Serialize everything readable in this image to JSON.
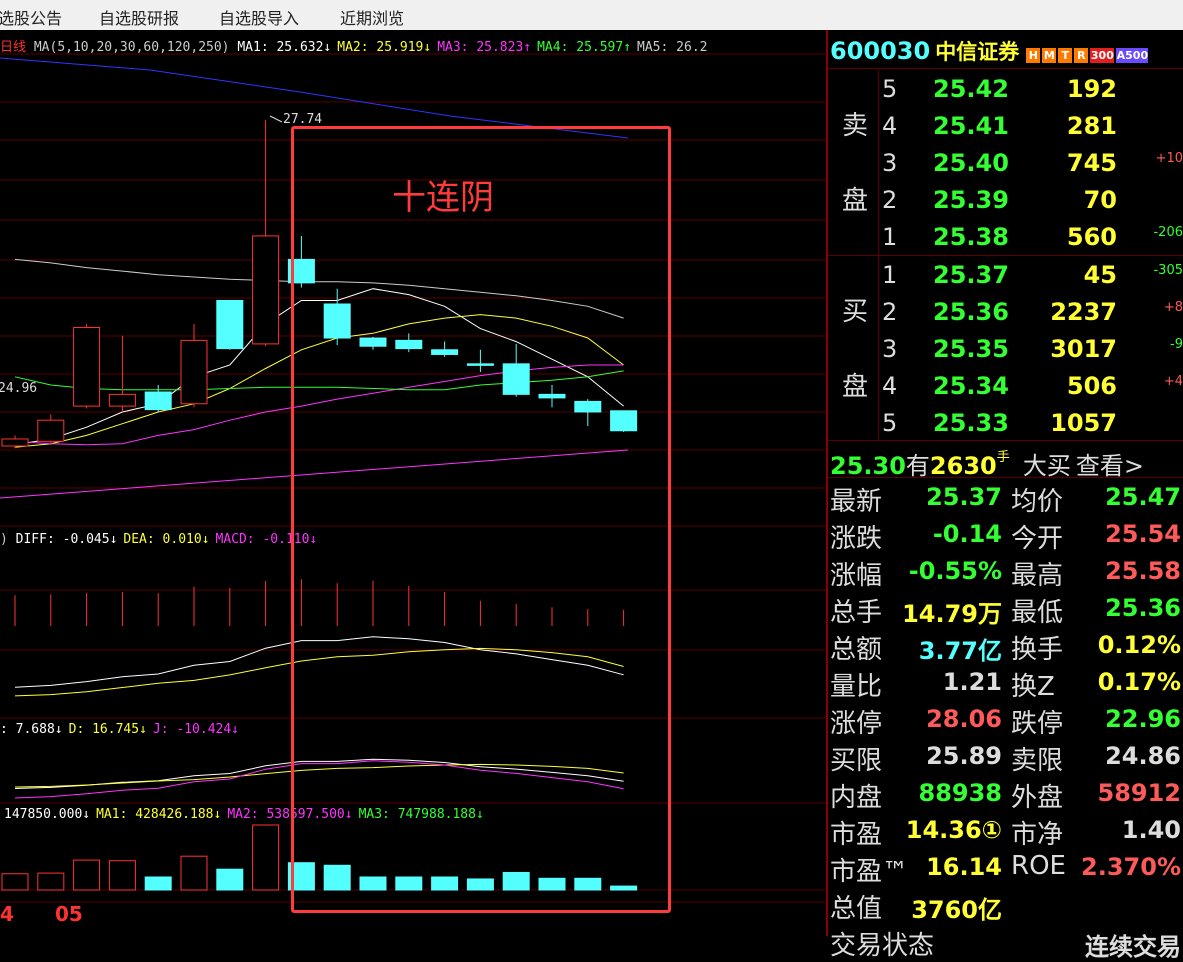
{
  "menu": {
    "items": [
      "选股公告",
      "自选股研报",
      "自选股导入",
      "近期浏览"
    ]
  },
  "chart": {
    "period_label": "日线",
    "ma_header": {
      "prefix": "MA(5,10,20,30,60,120,250)",
      "items": [
        {
          "label": "MA1: 25.632↓",
          "color": "#ffffff"
        },
        {
          "label": "MA2: 25.919↓",
          "color": "#ffff33"
        },
        {
          "label": "MA3: 25.823↑",
          "color": "#ff33ff"
        },
        {
          "label": "MA4: 25.597↑",
          "color": "#33ff33"
        },
        {
          "label": "MA5: 26.2",
          "color": "#cccccc"
        }
      ]
    },
    "high_marker": "27.74",
    "low_marker": "24.96",
    "annotation": "十连阴",
    "macd_header": {
      "prefix": ")",
      "items": [
        {
          "label": "DIFF: -0.045↓",
          "color": "#ffffff"
        },
        {
          "label": "DEA: 0.010↓",
          "color": "#ffff33"
        },
        {
          "label": "MACD: -0.110↓",
          "color": "#ff33ff"
        }
      ]
    },
    "kdj_header": {
      "items": [
        {
          "label": ": 7.688↓",
          "color": "#ffffff"
        },
        {
          "label": "D: 16.745↓",
          "color": "#ffff33"
        },
        {
          "label": "J: -10.424↓",
          "color": "#ff33ff"
        }
      ]
    },
    "vol_header": {
      "items": [
        {
          "label": "147850.000↓",
          "color": "#ffffff"
        },
        {
          "label": "MA1: 428426.188↓",
          "color": "#ffff33"
        },
        {
          "label": "MA2: 538597.500↓",
          "color": "#ff33ff"
        },
        {
          "label": "MA3: 747988.188↓",
          "color": "#33ff33"
        }
      ]
    },
    "date_labels": [
      "4",
      "05"
    ],
    "colors": {
      "up": "#ff3232",
      "down": "#54ffff",
      "grid": "#5a0000",
      "annotation_box": "#ff3b3b"
    }
  },
  "chart_data": {
    "type": "candlestick",
    "candles": [
      {
        "o": 24.96,
        "h": 25.05,
        "l": 24.94,
        "c": 25.02
      },
      {
        "o": 25.0,
        "h": 25.23,
        "l": 24.97,
        "c": 25.18
      },
      {
        "o": 25.3,
        "h": 26.0,
        "l": 25.28,
        "c": 25.97
      },
      {
        "o": 25.3,
        "h": 25.9,
        "l": 25.25,
        "c": 25.4
      },
      {
        "o": 25.42,
        "h": 25.48,
        "l": 25.25,
        "c": 25.27
      },
      {
        "o": 25.32,
        "h": 26.0,
        "l": 25.29,
        "c": 25.86
      },
      {
        "o": 26.2,
        "h": 26.2,
        "l": 25.78,
        "c": 25.79
      },
      {
        "o": 25.83,
        "h": 27.74,
        "l": 25.81,
        "c": 26.75
      },
      {
        "o": 26.55,
        "h": 26.75,
        "l": 26.31,
        "c": 26.35
      },
      {
        "o": 26.17,
        "h": 26.3,
        "l": 25.82,
        "c": 25.88
      },
      {
        "o": 25.88,
        "h": 25.89,
        "l": 25.78,
        "c": 25.81
      },
      {
        "o": 25.86,
        "h": 25.92,
        "l": 25.76,
        "c": 25.79
      },
      {
        "o": 25.78,
        "h": 25.85,
        "l": 25.72,
        "c": 25.74
      },
      {
        "o": 25.66,
        "h": 25.78,
        "l": 25.59,
        "c": 25.65
      },
      {
        "o": 25.66,
        "h": 25.83,
        "l": 25.38,
        "c": 25.4
      },
      {
        "o": 25.4,
        "h": 25.48,
        "l": 25.29,
        "c": 25.37
      },
      {
        "o": 25.34,
        "h": 25.36,
        "l": 25.13,
        "c": 25.25
      },
      {
        "o": 25.26,
        "h": 25.26,
        "l": 25.08,
        "c": 25.09
      }
    ],
    "ylim": [
      24.5,
      28.3
    ],
    "volume_ylim": [
      0,
      1000000
    ],
    "volumes": [
      250000,
      260000,
      460000,
      450000,
      200000,
      520000,
      320000,
      1000000,
      420000,
      380000,
      200000,
      200000,
      200000,
      170000,
      270000,
      180000,
      180000,
      60000
    ],
    "ma_lines": [
      {
        "name": "MA1",
        "color": "#ffffff",
        "values": [
          24.97,
          25.02,
          25.12,
          25.25,
          25.32,
          25.55,
          25.65,
          26.0,
          26.2,
          26.2,
          26.3,
          26.25,
          26.15,
          25.96,
          25.85,
          25.7,
          25.55,
          25.3
        ]
      },
      {
        "name": "MA2",
        "color": "#ffff33",
        "values": [
          24.95,
          24.98,
          25.05,
          25.15,
          25.25,
          25.32,
          25.45,
          25.62,
          25.78,
          25.88,
          25.92,
          26.0,
          26.05,
          26.08,
          26.05,
          25.98,
          25.88,
          25.65
        ]
      },
      {
        "name": "MA3",
        "color": "#ff33ff",
        "values": [
          25.0,
          24.98,
          24.97,
          24.98,
          25.05,
          25.1,
          25.18,
          25.25,
          25.3,
          25.36,
          25.41,
          25.46,
          25.51,
          25.56,
          25.6,
          25.63,
          25.65,
          25.65
        ]
      },
      {
        "name": "MA4",
        "color": "#33ff33",
        "values": [
          25.55,
          25.48,
          25.45,
          25.44,
          25.44,
          25.44,
          25.45,
          25.46,
          25.46,
          25.46,
          25.45,
          25.44,
          25.44,
          25.48,
          25.5,
          25.52,
          25.55,
          25.6
        ]
      },
      {
        "name": "MA5",
        "color": "#cccccc",
        "values": [
          26.55,
          26.52,
          26.48,
          26.45,
          26.42,
          26.4,
          26.38,
          26.37,
          26.36,
          26.36,
          26.35,
          26.33,
          26.3,
          26.27,
          26.24,
          26.2,
          26.15,
          26.05
        ]
      }
    ]
  },
  "quote": {
    "code": "600030",
    "name": "中信证券",
    "badges": [
      {
        "label": "H",
        "color": "#ff7a00"
      },
      {
        "label": "M",
        "color": "#ff7a00"
      },
      {
        "label": "T",
        "color": "#ff7a00"
      },
      {
        "label": "R",
        "color": "#ff7a00"
      },
      {
        "label": "300",
        "color": "#e02020"
      },
      {
        "label": "A500",
        "color": "#6a4bff"
      }
    ],
    "sell_label_top": "卖",
    "sell_label_bottom": "盘",
    "buy_label_top": "买",
    "buy_label_bottom": "盘",
    "sell": [
      {
        "level": "5",
        "price": "25.42",
        "vol": "192",
        "chg": ""
      },
      {
        "level": "4",
        "price": "25.41",
        "vol": "281",
        "chg": ""
      },
      {
        "level": "3",
        "price": "25.40",
        "vol": "745",
        "chg": "+10"
      },
      {
        "level": "2",
        "price": "25.39",
        "vol": "70",
        "chg": ""
      },
      {
        "level": "1",
        "price": "25.38",
        "vol": "560",
        "chg": "-206"
      }
    ],
    "buy": [
      {
        "level": "1",
        "price": "25.37",
        "vol": "45",
        "chg": "-305"
      },
      {
        "level": "2",
        "price": "25.36",
        "vol": "2237",
        "chg": "+8"
      },
      {
        "level": "3",
        "price": "25.35",
        "vol": "3017",
        "chg": "-9"
      },
      {
        "level": "4",
        "price": "25.34",
        "vol": "506",
        "chg": "+4"
      },
      {
        "level": "5",
        "price": "25.33",
        "vol": "1057",
        "chg": ""
      }
    ],
    "big_order": {
      "price": "25.30",
      "has": "有",
      "qty": "2630",
      "unit": "手",
      "type": "大买",
      "view": "查看>"
    },
    "stats": [
      {
        "l1": "最新",
        "v1": "25.37",
        "c1": "#33ff33",
        "l2": "均价",
        "v2": "25.47",
        "c2": "#33ff33"
      },
      {
        "l1": "涨跌",
        "v1": "-0.14",
        "c1": "#33ff33",
        "l2": "今开",
        "v2": "25.54",
        "c2": "#ff5a5a"
      },
      {
        "l1": "涨幅",
        "v1": "-0.55%",
        "c1": "#33ff33",
        "l2": "最高",
        "v2": "25.58",
        "c2": "#ff5a5a"
      },
      {
        "l1": "总手",
        "v1": "14.79万",
        "c1": "#ffff33",
        "l2": "最低",
        "v2": "25.36",
        "c2": "#33ff33"
      },
      {
        "l1": "总额",
        "v1": "3.77亿",
        "c1": "#54ffff",
        "l2": "换手",
        "v2": "0.12%",
        "c2": "#ffff33"
      },
      {
        "l1": "量比",
        "v1": "1.21",
        "c1": "#dddddd",
        "l2": "换Z",
        "v2": "0.17%",
        "c2": "#ffff33"
      },
      {
        "l1": "涨停",
        "v1": "28.06",
        "c1": "#ff5a5a",
        "l2": "跌停",
        "v2": "22.96",
        "c2": "#33ff33"
      },
      {
        "l1": "买限",
        "v1": "25.89",
        "c1": "#dddddd",
        "l2": "卖限",
        "v2": "24.86",
        "c2": "#dddddd"
      },
      {
        "l1": "内盘",
        "v1": "88938",
        "c1": "#33ff33",
        "l2": "外盘",
        "v2": "58912",
        "c2": "#ff5a5a"
      },
      {
        "l1": "市盈",
        "v1": "14.36①",
        "c1": "#ffff33",
        "l2": "市净",
        "v2": "1.40",
        "c2": "#dddddd"
      },
      {
        "l1": "市盈™",
        "v1": "16.14",
        "c1": "#ffff33",
        "l2": "ROE",
        "v2": "2.370%",
        "c2": "#ff5a5a"
      },
      {
        "l1": "总值",
        "v1": "3760亿",
        "c1": "#ffff33",
        "l2": "",
        "v2": "",
        "c2": "#dddddd"
      },
      {
        "l1": "交易状态",
        "v1": "",
        "c1": "#dddddd",
        "l2": "",
        "v2": "连续交易",
        "c2": "#dddddd"
      }
    ]
  }
}
